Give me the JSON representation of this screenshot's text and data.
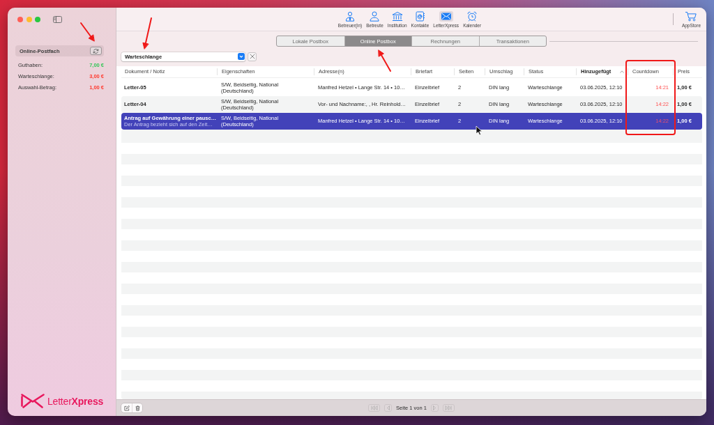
{
  "sidebar": {
    "section": {
      "title": "Online-Postfach"
    },
    "balances": [
      {
        "label": "Guthaben:",
        "value": "7,00 €",
        "color": "#34c759"
      },
      {
        "label": "Warteschlange:",
        "value": "3,00 €",
        "color": "#ff3b30"
      },
      {
        "label": "Auswahl-Betrag:",
        "value": "1,00 €",
        "color": "#ff3b30"
      }
    ],
    "logo": {
      "text": "Letter**Xpress**"
    }
  },
  "toolbar": {
    "items": [
      {
        "label": "Betreuer(in)",
        "selected": false
      },
      {
        "label": "Betreute",
        "selected": false
      },
      {
        "label": "Institution",
        "selected": false
      },
      {
        "label": "Kontakte",
        "selected": false
      },
      {
        "label": "LetterXpress",
        "selected": true
      },
      {
        "label": "Kalender",
        "selected": false
      }
    ],
    "store": {
      "label": "AppStore"
    }
  },
  "tabs": [
    {
      "label": "Lokale Postbox",
      "selected": false
    },
    {
      "label": "Online Postbox",
      "selected": true
    },
    {
      "label": "Rechnungen",
      "selected": false
    },
    {
      "label": "Transaktionen",
      "selected": false
    }
  ],
  "filter": {
    "value": "Warteschlange"
  },
  "table": {
    "columns": [
      {
        "label": "Dokument / Notiz",
        "sorted": false
      },
      {
        "label": "Eigenschaften",
        "sorted": false
      },
      {
        "label": "Adresse(n)",
        "sorted": false
      },
      {
        "label": "Briefart",
        "sorted": false
      },
      {
        "label": "Seiten",
        "sorted": false
      },
      {
        "label": "Umschlag",
        "sorted": false
      },
      {
        "label": "Status",
        "sorted": false
      },
      {
        "label": "Hinzugefügt",
        "sorted": true
      },
      {
        "label": "Countdown",
        "sorted": false
      },
      {
        "label": "Preis",
        "sorted": false
      }
    ],
    "rows": [
      {
        "selected": false,
        "document": "Letter-05",
        "properties": "S/W, Beidseitig, National (Deutschland)",
        "address": "Manfred Hetzel • Lange Str. 14 • 10…",
        "letter_type": "Einzelbrief",
        "pages": "2",
        "envelope": "DIN lang",
        "status": "Warteschlange",
        "added": "03.06.2025, 12:10",
        "countdown": "14:21",
        "price": "1,00 €"
      },
      {
        "selected": false,
        "document": "Letter-04",
        "properties": "S/W, Beidseitig, National (Deutschland)",
        "address": "Vor- und Nachname:, , Hr. Reinhold…",
        "letter_type": "Einzelbrief",
        "pages": "2",
        "envelope": "DIN lang",
        "status": "Warteschlange",
        "added": "03.06.2025, 12:10",
        "countdown": "14:22",
        "price": "1,00 €"
      },
      {
        "selected": true,
        "document": "Antrag auf Gewährung einer pausc…",
        "note": "Der Antrag bezieht sich auf den Zeit…",
        "properties": "S/W, Beidseitig, National (Deutschland)",
        "address": "Manfred Hetzel • Lange Str. 14 • 10…",
        "letter_type": "Einzelbrief",
        "pages": "2",
        "envelope": "DIN lang",
        "status": "Warteschlange",
        "added": "03.06.2025, 12:10",
        "countdown": "14:22",
        "price": "1,00 €"
      }
    ]
  },
  "pagination": {
    "text": "Seite 1 von 1",
    "buttons": [
      {
        "kind": "first",
        "disabled": true
      },
      {
        "kind": "previous",
        "disabled": true
      },
      {
        "kind": "next",
        "disabled": true
      },
      {
        "kind": "last",
        "disabled": true
      }
    ]
  }
}
